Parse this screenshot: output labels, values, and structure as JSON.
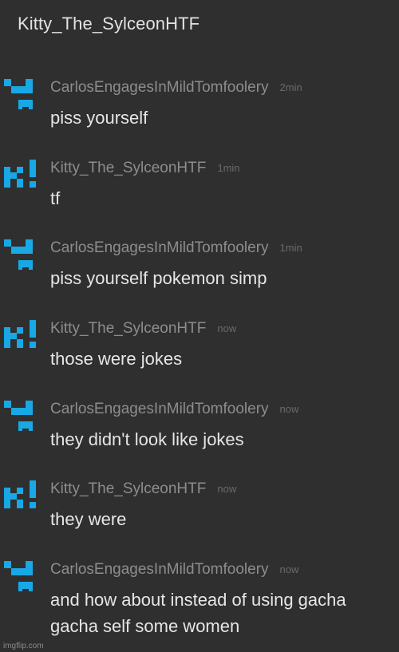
{
  "header": {
    "title": "Kitty_The_SylceonHTF"
  },
  "colors": {
    "background": "#2f2f2f",
    "avatar_blue": "#18a8e6",
    "username_gray": "#8d8d8d",
    "message_text": "#e6e6e6"
  },
  "messages": [
    {
      "user": "CarlosEngagesInMildTomfoolery",
      "time": "2min",
      "text": "piss yourself",
      "avatar": "avatar-carlos-icon"
    },
    {
      "user": "Kitty_The_SylceonHTF",
      "time": "1min",
      "text": "tf",
      "avatar": "avatar-kitty-icon"
    },
    {
      "user": "CarlosEngagesInMildTomfoolery",
      "time": "1min",
      "text": "piss yourself pokemon simp",
      "avatar": "avatar-carlos-icon"
    },
    {
      "user": "Kitty_The_SylceonHTF",
      "time": "now",
      "text": "those were jokes",
      "avatar": "avatar-kitty-icon"
    },
    {
      "user": "CarlosEngagesInMildTomfoolery",
      "time": "now",
      "text": "they didn't look like jokes",
      "avatar": "avatar-carlos-icon"
    },
    {
      "user": "Kitty_The_SylceonHTF",
      "time": "now",
      "text": "they were",
      "avatar": "avatar-kitty-icon"
    },
    {
      "user": "CarlosEngagesInMildTomfoolery",
      "time": "now",
      "text": "and how about instead of using gacha gacha self some women",
      "avatar": "avatar-carlos-icon"
    }
  ],
  "watermark": "imgflip.com"
}
